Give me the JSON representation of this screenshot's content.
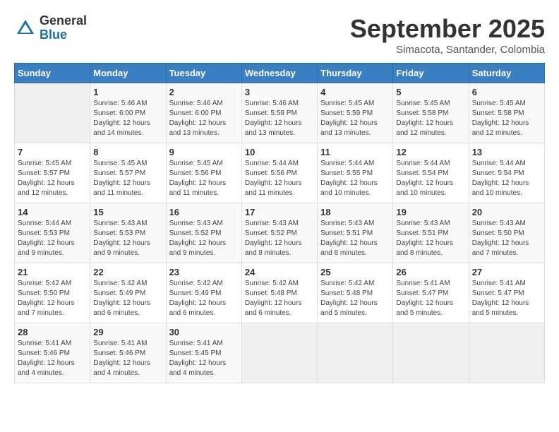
{
  "header": {
    "logo_general": "General",
    "logo_blue": "Blue",
    "month": "September 2025",
    "location": "Simacota, Santander, Colombia"
  },
  "days_of_week": [
    "Sunday",
    "Monday",
    "Tuesday",
    "Wednesday",
    "Thursday",
    "Friday",
    "Saturday"
  ],
  "weeks": [
    [
      {
        "day": "",
        "info": ""
      },
      {
        "day": "1",
        "info": "Sunrise: 5:46 AM\nSunset: 6:00 PM\nDaylight: 12 hours\nand 14 minutes."
      },
      {
        "day": "2",
        "info": "Sunrise: 5:46 AM\nSunset: 6:00 PM\nDaylight: 12 hours\nand 13 minutes."
      },
      {
        "day": "3",
        "info": "Sunrise: 5:46 AM\nSunset: 5:59 PM\nDaylight: 12 hours\nand 13 minutes."
      },
      {
        "day": "4",
        "info": "Sunrise: 5:45 AM\nSunset: 5:59 PM\nDaylight: 12 hours\nand 13 minutes."
      },
      {
        "day": "5",
        "info": "Sunrise: 5:45 AM\nSunset: 5:58 PM\nDaylight: 12 hours\nand 12 minutes."
      },
      {
        "day": "6",
        "info": "Sunrise: 5:45 AM\nSunset: 5:58 PM\nDaylight: 12 hours\nand 12 minutes."
      }
    ],
    [
      {
        "day": "7",
        "info": "Sunrise: 5:45 AM\nSunset: 5:57 PM\nDaylight: 12 hours\nand 12 minutes."
      },
      {
        "day": "8",
        "info": "Sunrise: 5:45 AM\nSunset: 5:57 PM\nDaylight: 12 hours\nand 11 minutes."
      },
      {
        "day": "9",
        "info": "Sunrise: 5:45 AM\nSunset: 5:56 PM\nDaylight: 12 hours\nand 11 minutes."
      },
      {
        "day": "10",
        "info": "Sunrise: 5:44 AM\nSunset: 5:56 PM\nDaylight: 12 hours\nand 11 minutes."
      },
      {
        "day": "11",
        "info": "Sunrise: 5:44 AM\nSunset: 5:55 PM\nDaylight: 12 hours\nand 10 minutes."
      },
      {
        "day": "12",
        "info": "Sunrise: 5:44 AM\nSunset: 5:54 PM\nDaylight: 12 hours\nand 10 minutes."
      },
      {
        "day": "13",
        "info": "Sunrise: 5:44 AM\nSunset: 5:54 PM\nDaylight: 12 hours\nand 10 minutes."
      }
    ],
    [
      {
        "day": "14",
        "info": "Sunrise: 5:44 AM\nSunset: 5:53 PM\nDaylight: 12 hours\nand 9 minutes."
      },
      {
        "day": "15",
        "info": "Sunrise: 5:43 AM\nSunset: 5:53 PM\nDaylight: 12 hours\nand 9 minutes."
      },
      {
        "day": "16",
        "info": "Sunrise: 5:43 AM\nSunset: 5:52 PM\nDaylight: 12 hours\nand 9 minutes."
      },
      {
        "day": "17",
        "info": "Sunrise: 5:43 AM\nSunset: 5:52 PM\nDaylight: 12 hours\nand 8 minutes."
      },
      {
        "day": "18",
        "info": "Sunrise: 5:43 AM\nSunset: 5:51 PM\nDaylight: 12 hours\nand 8 minutes."
      },
      {
        "day": "19",
        "info": "Sunrise: 5:43 AM\nSunset: 5:51 PM\nDaylight: 12 hours\nand 8 minutes."
      },
      {
        "day": "20",
        "info": "Sunrise: 5:43 AM\nSunset: 5:50 PM\nDaylight: 12 hours\nand 7 minutes."
      }
    ],
    [
      {
        "day": "21",
        "info": "Sunrise: 5:42 AM\nSunset: 5:50 PM\nDaylight: 12 hours\nand 7 minutes."
      },
      {
        "day": "22",
        "info": "Sunrise: 5:42 AM\nSunset: 5:49 PM\nDaylight: 12 hours\nand 6 minutes."
      },
      {
        "day": "23",
        "info": "Sunrise: 5:42 AM\nSunset: 5:49 PM\nDaylight: 12 hours\nand 6 minutes."
      },
      {
        "day": "24",
        "info": "Sunrise: 5:42 AM\nSunset: 5:48 PM\nDaylight: 12 hours\nand 6 minutes."
      },
      {
        "day": "25",
        "info": "Sunrise: 5:42 AM\nSunset: 5:48 PM\nDaylight: 12 hours\nand 5 minutes."
      },
      {
        "day": "26",
        "info": "Sunrise: 5:41 AM\nSunset: 5:47 PM\nDaylight: 12 hours\nand 5 minutes."
      },
      {
        "day": "27",
        "info": "Sunrise: 5:41 AM\nSunset: 5:47 PM\nDaylight: 12 hours\nand 5 minutes."
      }
    ],
    [
      {
        "day": "28",
        "info": "Sunrise: 5:41 AM\nSunset: 5:46 PM\nDaylight: 12 hours\nand 4 minutes."
      },
      {
        "day": "29",
        "info": "Sunrise: 5:41 AM\nSunset: 5:46 PM\nDaylight: 12 hours\nand 4 minutes."
      },
      {
        "day": "30",
        "info": "Sunrise: 5:41 AM\nSunset: 5:45 PM\nDaylight: 12 hours\nand 4 minutes."
      },
      {
        "day": "",
        "info": ""
      },
      {
        "day": "",
        "info": ""
      },
      {
        "day": "",
        "info": ""
      },
      {
        "day": "",
        "info": ""
      }
    ]
  ]
}
